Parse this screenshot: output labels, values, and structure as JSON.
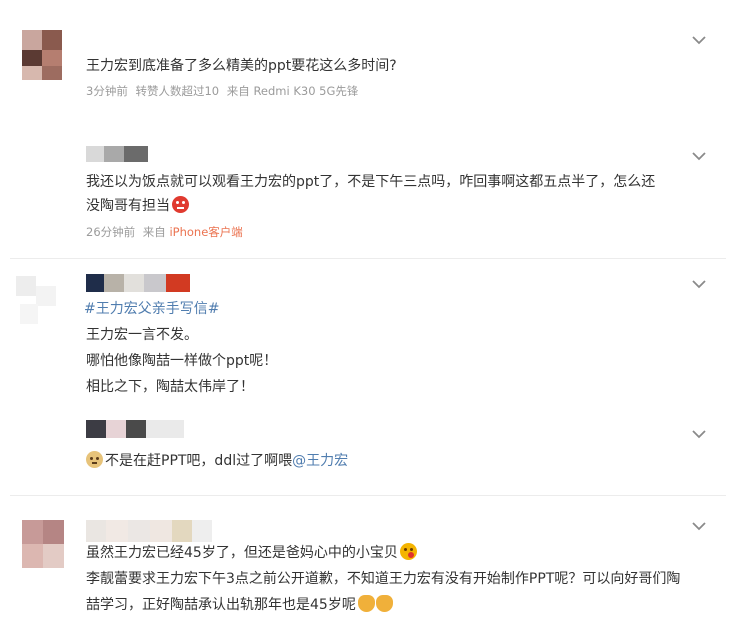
{
  "comments": [
    {
      "text": "王力宏到底准备了多么精美的ppt要花这么多时间?",
      "meta": {
        "time": "3分钟前",
        "reposts": "转赞人数超过10",
        "source_prefix": "来自",
        "source": "Redmi K30 5G先锋"
      }
    },
    {
      "line1": "我还以为饭点就可以观看王力宏的ppt了，不是下午三点吗，咋回事啊这都五点半了，怎么还",
      "line2": "没陶哥有担当",
      "meta": {
        "time": "26分钟前",
        "source_prefix": "来自",
        "source": "iPhone客户端"
      }
    },
    {
      "hashtag": "#王力宏父亲手写信#",
      "line1": "王力宏一言不发。",
      "line2": "哪怕他像陶喆一样做个ppt呢！",
      "line3": "相比之下，陶喆太伟岸了！"
    },
    {
      "text": "不是在赶PPT吧，ddl过了啊喂",
      "mention": "@王力宏"
    },
    {
      "line1": "虽然王力宏已经45岁了，但还是爸妈心中的小宝贝",
      "line2": "李靓蕾要求王力宏下午3点之前公开道歉，不知道王力宏有没有开始制作PPT呢？可以向好哥们陶",
      "line3": "喆学习，正好陶喆承认出轨那年也是45岁呢"
    }
  ],
  "icons": {
    "expand": "chevron-down-icon",
    "emoji_red": "angry-red-face-emoji",
    "emoji_doge": "doge-emoji",
    "emoji_kiss": "kiss-emoji",
    "emoji_clap": "clap-emoji"
  },
  "colors": {
    "link": "#507daf",
    "source_link": "#eb7350",
    "meta": "#9b9b9b",
    "text": "#333333"
  }
}
